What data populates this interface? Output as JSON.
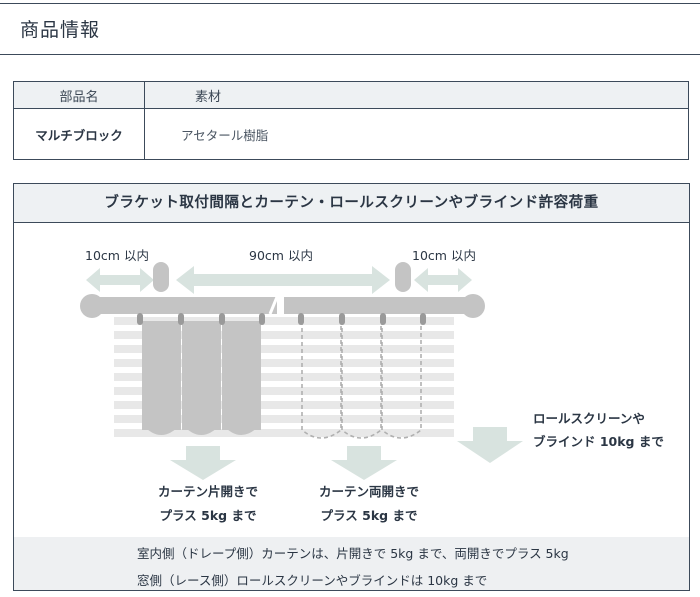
{
  "header": {
    "title": "商品情報"
  },
  "spec_table": {
    "col_part": "部品名",
    "col_material": "素材",
    "row_part": "マルチブロック",
    "row_material": "アセタール樹脂"
  },
  "diagram": {
    "title": "ブラケット取付間隔とカーテン・ロールスクリーンやブラインド許容荷重",
    "spacing_left": "10cm 以内",
    "spacing_middle": "90cm 以内",
    "spacing_right": "10cm 以内",
    "label_single_line1": "カーテン片開きで",
    "label_single_line2": "プラス 5kg まで",
    "label_double_line1": "カーテン両開きで",
    "label_double_line2": "プラス 5kg まで",
    "label_blind_line1": "ロールスクリーンや",
    "label_blind_line2": "ブラインド 10kg まで",
    "footer_line1": "室内側（ドレープ側）カーテンは、片開きで 5kg まで、両開きでプラス 5kg",
    "footer_line2": "窓側（レース側）ロールスクリーンやブラインドは 10kg まで"
  },
  "colors": {
    "border": "#3c4a5a",
    "rail": "#c4c4c4",
    "arrow": "#d8e3df",
    "header_fill": "#eef1f3"
  }
}
